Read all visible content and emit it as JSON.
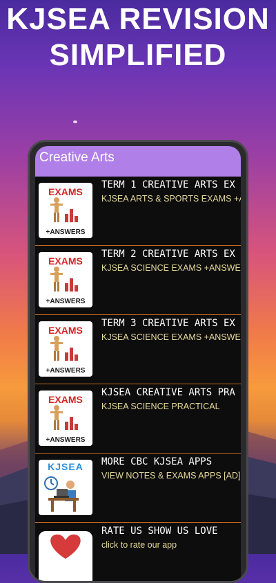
{
  "headline": {
    "line1": "KJSEA REVISION",
    "line2": "SIMPLIFIED"
  },
  "app": {
    "title": "Creative Arts",
    "items": [
      {
        "title": "TERM 1 CREATIVE ARTS EX",
        "subtitle": "KJSEA ARTS & SPORTS EXAMS +AN",
        "thumb_top": "EXAMS",
        "thumb_bottom": "+ANSWERS"
      },
      {
        "title": "TERM 2 CREATIVE ARTS EX",
        "subtitle": "KJSEA SCIENCE EXAMS +ANSWER",
        "thumb_top": "EXAMS",
        "thumb_bottom": "+ANSWERS"
      },
      {
        "title": "TERM 3 CREATIVE ARTS EX",
        "subtitle": "KJSEA SCIENCE EXAMS +ANSWER",
        "thumb_top": "EXAMS",
        "thumb_bottom": "+ANSWERS"
      },
      {
        "title": "KJSEA CREATIVE ARTS PRA",
        "subtitle": "KJSEA SCIENCE PRACTICAL",
        "thumb_top": "EXAMS",
        "thumb_bottom": "+ANSWERS"
      },
      {
        "title": "MORE CBC KJSEA APPS",
        "subtitle": "VIEW NOTES & EXAMS APPS [AD]",
        "thumb_top": "KJSEA"
      },
      {
        "title": "RATE US SHOW US LOVE",
        "subtitle": "click to rate our app"
      }
    ]
  },
  "colors": {
    "appbar": "#b07fe8",
    "divider": "#c46a22",
    "subtitle": "#e6d99a",
    "exams_red": "#d6242a"
  },
  "icons": [
    "exams-answers-icon",
    "kjsea-student-icon",
    "heart-icon"
  ]
}
